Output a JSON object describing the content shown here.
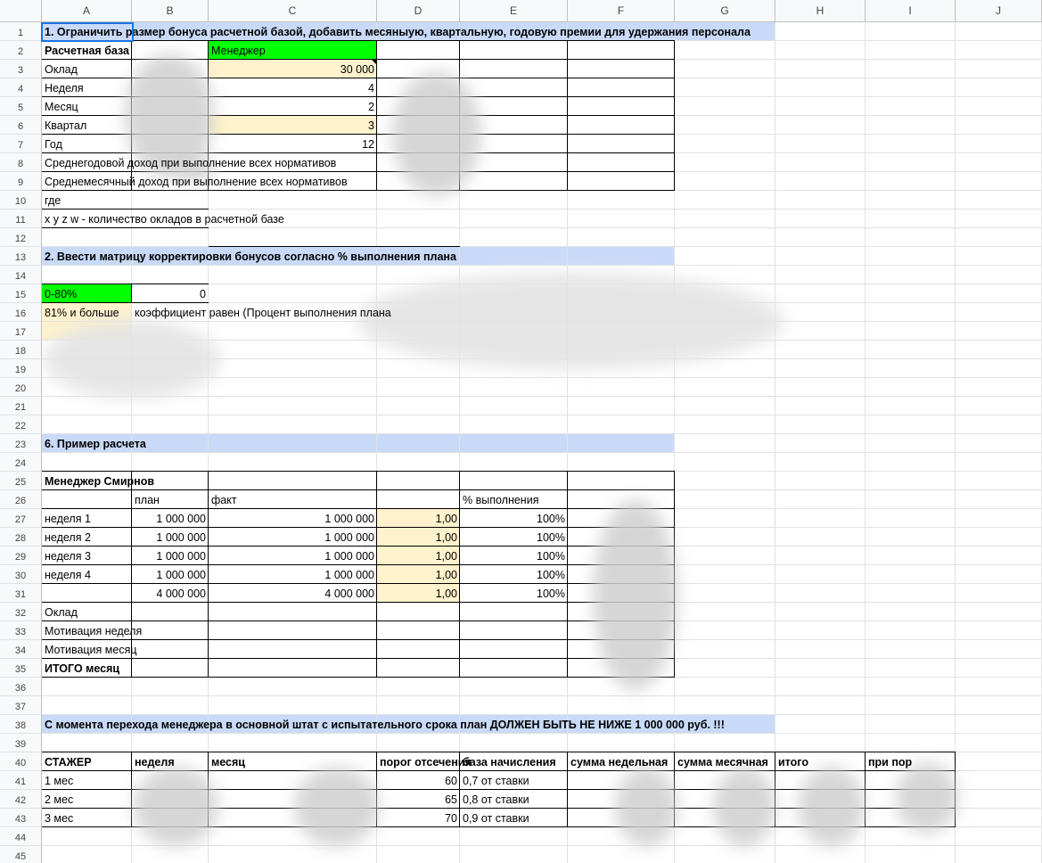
{
  "columns": [
    "A",
    "B",
    "C",
    "D",
    "E",
    "F",
    "G",
    "H",
    "I",
    "J"
  ],
  "rows": [
    "1",
    "2",
    "3",
    "4",
    "5",
    "6",
    "7",
    "8",
    "9",
    "10",
    "11",
    "12",
    "13",
    "14",
    "15",
    "16",
    "17",
    "18",
    "19",
    "20",
    "21",
    "22",
    "23",
    "24",
    "25",
    "26",
    "27",
    "28",
    "29",
    "30",
    "31",
    "32",
    "33",
    "34",
    "35",
    "36",
    "37",
    "38",
    "39",
    "40",
    "41",
    "42",
    "43",
    "44",
    "45"
  ],
  "cells": [
    {
      "r": 1,
      "c": "A",
      "t": "1. Ограничить размер бонуса расчетной базой, добавить месяныую, квартальную, годовую премии для удержания персонала",
      "b": true
    },
    {
      "r": 2,
      "c": "A",
      "t": "Расчетная база",
      "b": true
    },
    {
      "r": 2,
      "c": "C",
      "t": "Менеджер"
    },
    {
      "r": 3,
      "c": "A",
      "t": "Оклад"
    },
    {
      "r": 3,
      "c": "C",
      "t": "30 000",
      "al": "r"
    },
    {
      "r": 4,
      "c": "A",
      "t": "Неделя"
    },
    {
      "r": 4,
      "c": "C",
      "t": "4",
      "al": "r"
    },
    {
      "r": 5,
      "c": "A",
      "t": "Месяц"
    },
    {
      "r": 5,
      "c": "C",
      "t": "2",
      "al": "r"
    },
    {
      "r": 6,
      "c": "A",
      "t": "Квартал"
    },
    {
      "r": 6,
      "c": "C",
      "t": "3",
      "al": "r"
    },
    {
      "r": 7,
      "c": "A",
      "t": "Год"
    },
    {
      "r": 7,
      "c": "C",
      "t": "12",
      "al": "r"
    },
    {
      "r": 8,
      "c": "A",
      "t": "Среднегодовой доход при выполнение всех нормативов"
    },
    {
      "r": 9,
      "c": "A",
      "t": "Среднемесячный доход при выполнение всех нормативов"
    },
    {
      "r": 10,
      "c": "A",
      "t": "где"
    },
    {
      "r": 11,
      "c": "A",
      "t": "x y z w  - количество окладов в расчетной базе"
    },
    {
      "r": 13,
      "c": "A",
      "t": "2. Ввести матрицу корректировки бонусов согласно % выполнения плана",
      "b": true
    },
    {
      "r": 15,
      "c": "A",
      "t": "0-80%"
    },
    {
      "r": 15,
      "c": "B",
      "t": "0",
      "al": "r"
    },
    {
      "r": 16,
      "c": "A",
      "t": "81% и больше"
    },
    {
      "r": 16,
      "c": "B",
      "t": "коэффициент равен (Процент выполнения плана"
    },
    {
      "r": 23,
      "c": "A",
      "t": "6. Пример расчета",
      "b": true
    },
    {
      "r": 25,
      "c": "A",
      "t": "Менеджер Смирнов",
      "b": true
    },
    {
      "r": 26,
      "c": "B",
      "t": "план"
    },
    {
      "r": 26,
      "c": "C",
      "t": "факт"
    },
    {
      "r": 26,
      "c": "E",
      "t": "% выполнения"
    },
    {
      "r": 27,
      "c": "A",
      "t": "неделя 1"
    },
    {
      "r": 27,
      "c": "B",
      "t": "1 000 000",
      "al": "r"
    },
    {
      "r": 27,
      "c": "C",
      "t": "1 000 000",
      "al": "r"
    },
    {
      "r": 27,
      "c": "D",
      "t": "1,00",
      "al": "r"
    },
    {
      "r": 27,
      "c": "E",
      "t": "100%",
      "al": "r"
    },
    {
      "r": 28,
      "c": "A",
      "t": "неделя 2"
    },
    {
      "r": 28,
      "c": "B",
      "t": "1 000 000",
      "al": "r"
    },
    {
      "r": 28,
      "c": "C",
      "t": "1 000 000",
      "al": "r"
    },
    {
      "r": 28,
      "c": "D",
      "t": "1,00",
      "al": "r"
    },
    {
      "r": 28,
      "c": "E",
      "t": "100%",
      "al": "r"
    },
    {
      "r": 29,
      "c": "A",
      "t": "неделя 3"
    },
    {
      "r": 29,
      "c": "B",
      "t": "1 000 000",
      "al": "r"
    },
    {
      "r": 29,
      "c": "C",
      "t": "1 000 000",
      "al": "r"
    },
    {
      "r": 29,
      "c": "D",
      "t": "1,00",
      "al": "r"
    },
    {
      "r": 29,
      "c": "E",
      "t": "100%",
      "al": "r"
    },
    {
      "r": 30,
      "c": "A",
      "t": "неделя 4"
    },
    {
      "r": 30,
      "c": "B",
      "t": "1 000 000",
      "al": "r"
    },
    {
      "r": 30,
      "c": "C",
      "t": "1 000 000",
      "al": "r"
    },
    {
      "r": 30,
      "c": "D",
      "t": "1,00",
      "al": "r"
    },
    {
      "r": 30,
      "c": "E",
      "t": "100%",
      "al": "r"
    },
    {
      "r": 31,
      "c": "B",
      "t": "4 000 000",
      "al": "r"
    },
    {
      "r": 31,
      "c": "C",
      "t": "4 000 000",
      "al": "r"
    },
    {
      "r": 31,
      "c": "D",
      "t": "1,00",
      "al": "r"
    },
    {
      "r": 31,
      "c": "E",
      "t": "100%",
      "al": "r"
    },
    {
      "r": 32,
      "c": "A",
      "t": "Оклад"
    },
    {
      "r": 33,
      "c": "A",
      "t": "Мотивация неделя"
    },
    {
      "r": 34,
      "c": "A",
      "t": "Мотивация месяц"
    },
    {
      "r": 35,
      "c": "A",
      "t": "ИТОГО месяц",
      "b": true
    },
    {
      "r": 38,
      "c": "A",
      "t": "С момента перехода менеджера в основной штат с испытательного срока план ДОЛЖЕН БЫТЬ НЕ НИЖЕ 1 000 000 руб. !!!",
      "b": true
    },
    {
      "r": 40,
      "c": "A",
      "t": "СТАЖЕР",
      "b": true
    },
    {
      "r": 40,
      "c": "B",
      "t": "неделя",
      "b": true
    },
    {
      "r": 40,
      "c": "C",
      "t": "месяц",
      "b": true
    },
    {
      "r": 40,
      "c": "D",
      "t": "порог отсечения",
      "b": true
    },
    {
      "r": 40,
      "c": "E",
      "t": "база начисления",
      "b": true
    },
    {
      "r": 40,
      "c": "F",
      "t": "сумма недельная",
      "b": true
    },
    {
      "r": 40,
      "c": "G",
      "t": "сумма месячная",
      "b": true
    },
    {
      "r": 40,
      "c": "H",
      "t": "итого",
      "b": true
    },
    {
      "r": 40,
      "c": "I",
      "t": "при пор",
      "b": true
    },
    {
      "r": 41,
      "c": "A",
      "t": "1 мес"
    },
    {
      "r": 41,
      "c": "D",
      "t": "60",
      "al": "r"
    },
    {
      "r": 41,
      "c": "E",
      "t": "0,7 от ставки"
    },
    {
      "r": 42,
      "c": "A",
      "t": "2 мес"
    },
    {
      "r": 42,
      "c": "D",
      "t": "65",
      "al": "r"
    },
    {
      "r": 42,
      "c": "E",
      "t": "0,8 от ставки"
    },
    {
      "r": 43,
      "c": "A",
      "t": "3 мес"
    },
    {
      "r": 43,
      "c": "D",
      "t": "70",
      "al": "r"
    },
    {
      "r": 43,
      "c": "E",
      "t": "0,9 от ставки"
    }
  ],
  "colors": {
    "header_blue": "#c9daf8",
    "green": "#00ff00",
    "light_yellow": "#fff2cc",
    "selection": "#1a73e8"
  }
}
